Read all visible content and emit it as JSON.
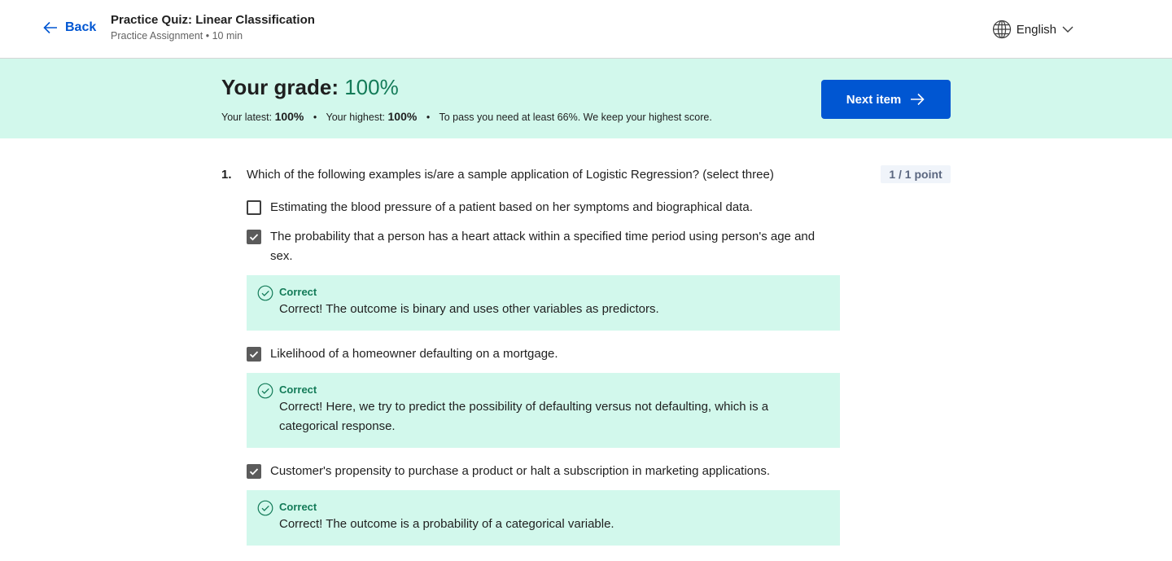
{
  "header": {
    "back_label": "Back",
    "title": "Practice Quiz: Linear Classification",
    "subtitle": "Practice Assignment • 10 min",
    "language": "English"
  },
  "grade": {
    "label": "Your grade:",
    "value": "100%",
    "latest_label": "Your latest:",
    "latest_value": "100%",
    "highest_label": "Your highest:",
    "highest_value": "100%",
    "pass_note": "To pass you need at least 66%. We keep your highest score.",
    "next_button": "Next item"
  },
  "question": {
    "number": "1.",
    "text": "Which of the following examples is/are a sample application of Logistic Regression? (select three)",
    "points": "1 / 1 point",
    "options": [
      {
        "text": "Estimating the blood pressure of a patient based on her symptoms and biographical data.",
        "checked": false
      },
      {
        "text": "The probability that a person has a heart attack within a specified time period using person's age and sex.",
        "checked": true,
        "feedback_title": "Correct",
        "feedback_text": "Correct! The outcome is binary and uses other variables as predictors."
      },
      {
        "text": "Likelihood of a homeowner defaulting on a mortgage.",
        "checked": true,
        "feedback_title": "Correct",
        "feedback_text": "Correct! Here, we try to predict the possibility of defaulting versus not defaulting, which is a categorical response."
      },
      {
        "text": "Customer's propensity to purchase a product or halt a subscription in marketing applications.",
        "checked": true,
        "feedback_title": "Correct",
        "feedback_text": "Correct! The outcome is a probability of a categorical variable."
      }
    ]
  },
  "colors": {
    "accent": "#0056d2",
    "success": "#137b58",
    "success_bg": "#d2f8ec"
  },
  "icons": [
    "back-arrow-icon",
    "globe-icon",
    "chevron-down-icon",
    "arrow-right-icon",
    "checkmark-icon",
    "check-circle-icon"
  ]
}
